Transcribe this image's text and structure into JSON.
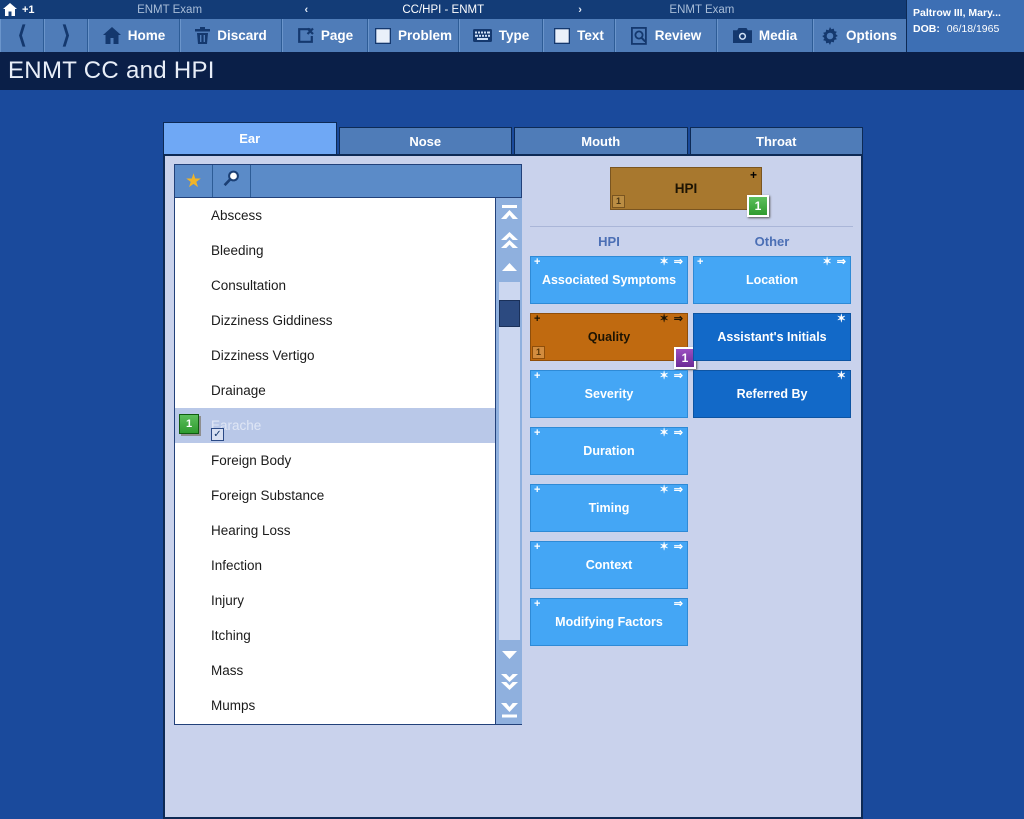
{
  "titlebar": {
    "plus_label": "+1",
    "home_icon": "home-icon",
    "segments": [
      {
        "label": "ENMT Exam",
        "active": false
      },
      {
        "label": "CC/HPI - ENMT",
        "active": true
      },
      {
        "label": "ENMT Exam",
        "active": false
      }
    ],
    "chevron_left": "‹",
    "chevron_right": "›"
  },
  "toolbar": {
    "back_icon": "chevron-left-icon",
    "forward_icon": "chevron-right-icon",
    "buttons": [
      {
        "label": "Home",
        "icon": "home-icon"
      },
      {
        "label": "Discard",
        "icon": "trash-icon"
      },
      {
        "label": "Page",
        "icon": "page-x-icon"
      },
      {
        "label": "Problem",
        "icon": "square-icon"
      },
      {
        "label": "Type",
        "icon": "keyboard-icon"
      },
      {
        "label": "Text",
        "icon": "square-icon"
      },
      {
        "label": "Review",
        "icon": "magnifier-doc-icon"
      },
      {
        "label": "Media",
        "icon": "camera-icon"
      },
      {
        "label": "Options",
        "icon": "gear-icon"
      }
    ],
    "options_caret": "▼"
  },
  "patient": {
    "name": "Paltrow III, Mary...",
    "dob_label": "DOB:",
    "dob_value": "06/18/1965"
  },
  "page": {
    "title": "ENMT CC and HPI"
  },
  "tabs": [
    {
      "label": "Ear",
      "active": true
    },
    {
      "label": "Nose",
      "active": false
    },
    {
      "label": "Mouth",
      "active": false
    },
    {
      "label": "Throat",
      "active": false
    }
  ],
  "list": {
    "header": {
      "star_icon": "star-icon",
      "search_icon": "magnifier-icon",
      "search_value": "",
      "search_placeholder": ""
    },
    "items": [
      {
        "label": "Abscess",
        "selected": false,
        "badge": null,
        "checked": false
      },
      {
        "label": "Bleeding",
        "selected": false,
        "badge": null,
        "checked": false
      },
      {
        "label": "Consultation",
        "selected": false,
        "badge": null,
        "checked": false
      },
      {
        "label": "Dizziness Giddiness",
        "selected": false,
        "badge": null,
        "checked": false
      },
      {
        "label": "Dizziness Vertigo",
        "selected": false,
        "badge": null,
        "checked": false
      },
      {
        "label": "Drainage",
        "selected": false,
        "badge": null,
        "checked": false
      },
      {
        "label": "Earache",
        "selected": true,
        "badge": "1",
        "checked": true
      },
      {
        "label": "Foreign Body",
        "selected": false,
        "badge": null,
        "checked": false
      },
      {
        "label": "Foreign Substance",
        "selected": false,
        "badge": null,
        "checked": false
      },
      {
        "label": "Hearing Loss",
        "selected": false,
        "badge": null,
        "checked": false
      },
      {
        "label": "Infection",
        "selected": false,
        "badge": null,
        "checked": false
      },
      {
        "label": "Injury",
        "selected": false,
        "badge": null,
        "checked": false
      },
      {
        "label": "Itching",
        "selected": false,
        "badge": null,
        "checked": false
      },
      {
        "label": "Mass",
        "selected": false,
        "badge": null,
        "checked": false
      },
      {
        "label": "Mumps",
        "selected": false,
        "badge": null,
        "checked": false
      }
    ],
    "scrollbar": {
      "top_most_icon": "scroll-top-most-icon",
      "page_up_icon": "scroll-page-up-icon",
      "line_up_icon": "scroll-line-up-icon",
      "line_down_icon": "scroll-line-down-icon",
      "page_down_icon": "scroll-page-down-icon",
      "bottom_most_icon": "scroll-bottom-most-icon"
    }
  },
  "hpi_header": {
    "label": "HPI",
    "plus": "+",
    "corner_number": "1",
    "badge": "1"
  },
  "columns": {
    "hpi_label": "HPI",
    "other_label": "Other"
  },
  "hpi_buttons": [
    {
      "label": "Associated Symptoms",
      "style": "light",
      "plus": "+",
      "icons": "✶ ⇒",
      "badge": null,
      "corner_number": null
    },
    {
      "label": "Quality",
      "style": "selected",
      "plus": "+",
      "icons": "✶ ⇒",
      "badge": "1",
      "corner_number": "1"
    },
    {
      "label": "Severity",
      "style": "light",
      "plus": "+",
      "icons": "✶ ⇒",
      "badge": null,
      "corner_number": null
    },
    {
      "label": "Duration",
      "style": "light",
      "plus": "+",
      "icons": "✶ ⇒",
      "badge": null,
      "corner_number": null
    },
    {
      "label": "Timing",
      "style": "light",
      "plus": "+",
      "icons": "✶ ⇒",
      "badge": null,
      "corner_number": null
    },
    {
      "label": "Context",
      "style": "light",
      "plus": "+",
      "icons": "✶ ⇒",
      "badge": null,
      "corner_number": null
    },
    {
      "label": "Modifying Factors",
      "style": "light",
      "plus": "+",
      "icons": "⇒",
      "badge": null,
      "corner_number": null
    }
  ],
  "other_buttons": [
    {
      "label": "Location",
      "style": "light",
      "plus": "+",
      "icons": "✶ ⇒",
      "badge": null,
      "corner_number": null
    },
    {
      "label": "Assistant's Initials",
      "style": "dark",
      "plus": "",
      "icons": "✶",
      "badge": null,
      "corner_number": null
    },
    {
      "label": "Referred By",
      "style": "dark",
      "plus": "",
      "icons": "✶",
      "badge": null,
      "corner_number": null
    }
  ],
  "colors": {
    "page_background": "#1a4a9c",
    "panel_background": "#c9d2ec",
    "toolbar": "#4f7cb8",
    "titlebar": "#133c77",
    "title_banner": "#0a1f48",
    "button_light": "#44a6f5",
    "button_dark": "#1269c8",
    "button_selected": "#c06a10",
    "hpi_header": "#a8782e",
    "badge_green": "#2f9b2f",
    "badge_purple": "#6b2a96",
    "star": "#f0b429"
  }
}
